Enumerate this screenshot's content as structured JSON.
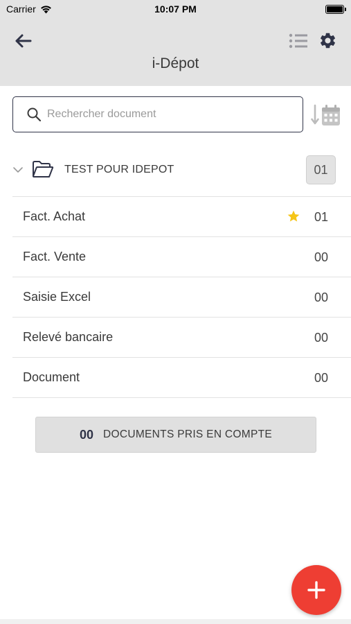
{
  "status_bar": {
    "carrier": "Carrier",
    "time": "10:07 PM"
  },
  "header": {
    "title": "i-Dépot",
    "back_icon": "arrow-left-icon",
    "list_icon": "list-icon",
    "settings_icon": "gear-icon"
  },
  "search": {
    "placeholder": "Rechercher document",
    "value": "",
    "sort_icon": "sort-by-date-icon"
  },
  "folder": {
    "name": "TEST POUR IDEPOT",
    "count": "01",
    "expanded_icon": "chevron-down-icon",
    "folder_icon": "open-folder-icon"
  },
  "categories": [
    {
      "label": "Fact. Achat",
      "count": "01",
      "starred": true
    },
    {
      "label": "Fact. Vente",
      "count": "00",
      "starred": false
    },
    {
      "label": "Saisie Excel",
      "count": "00",
      "starred": false
    },
    {
      "label": "Relevé bancaire",
      "count": "00",
      "starred": false
    },
    {
      "label": "Document",
      "count": "00",
      "starred": false
    }
  ],
  "summary": {
    "count": "00",
    "label": "DOCUMENTS PRIS EN COMPTE"
  },
  "fab": {
    "icon": "plus-icon"
  },
  "colors": {
    "header_bg": "#e3e3e3",
    "accent_dark": "#2f3347",
    "star": "#f5c518",
    "fab": "#ee3e33"
  }
}
